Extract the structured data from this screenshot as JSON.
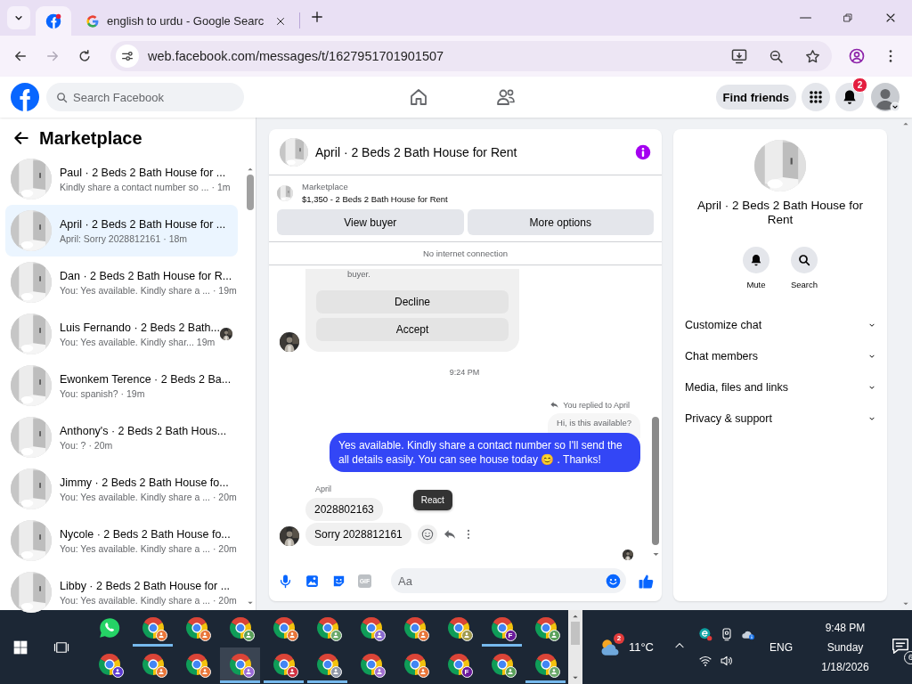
{
  "browser": {
    "tabs": [
      {
        "kind": "facebook",
        "selected": true
      },
      {
        "kind": "google",
        "title": "english to urdu - Google Searc",
        "selected": false
      }
    ],
    "nav": [
      {
        "kind": "back",
        "disabled": false
      },
      {
        "kind": "forward",
        "disabled": true
      },
      {
        "kind": "reload",
        "disabled": false
      }
    ],
    "url": "web.facebook.com/messages/t/1627951701901507"
  },
  "header": {
    "search_placeholder": "Search Facebook",
    "find_friends": "Find friends",
    "notification_count": "2"
  },
  "sidebar": {
    "title": "Marketplace",
    "conversations": [
      {
        "title": "Paul · 2 Beds 2 Bath House for ...",
        "preview": "Kindly share a contact number so ...",
        "time": "· 1m",
        "selected": false,
        "seen_avatar": false
      },
      {
        "title": "April · 2 Beds 2 Bath House for ...",
        "preview": "April: Sorry 2028812161",
        "time": "· 18m",
        "selected": true,
        "seen_avatar": false
      },
      {
        "title": "Dan · 2 Beds 2 Bath House for R...",
        "preview": "You: Yes available. Kindly share a ...",
        "time": "· 19m",
        "selected": false,
        "seen_avatar": false
      },
      {
        "title": "Luis Fernando · 2 Beds 2 Bath...",
        "preview": "You: Yes available. Kindly shar...",
        "time": "19m",
        "selected": false,
        "seen_avatar": true
      },
      {
        "title": "Ewonkem Terence · 2 Beds 2 Ba...",
        "preview": "You: spanish?",
        "time": "· 19m",
        "selected": false,
        "seen_avatar": false
      },
      {
        "title": "Anthony's · 2 Beds 2 Bath Hous...",
        "preview": "You: ?",
        "time": "· 20m",
        "selected": false,
        "seen_avatar": false
      },
      {
        "title": "Jimmy · 2 Beds 2 Bath House fo...",
        "preview": "You: Yes available. Kindly share a ...",
        "time": "· 20m",
        "selected": false,
        "seen_avatar": false
      },
      {
        "title": "Nycole · 2 Beds 2 Bath House fo...",
        "preview": "You: Yes available. Kindly share a ...",
        "time": "· 20m",
        "selected": false,
        "seen_avatar": false
      },
      {
        "title": "Libby · 2 Beds 2 Bath House for ...",
        "preview": "You: Yes available. Kindly share a ...",
        "time": "· 20m",
        "selected": false,
        "seen_avatar": false
      }
    ]
  },
  "chat": {
    "title": "April · 2 Beds 2 Bath House for Rent",
    "listing": {
      "label": "Marketplace",
      "price_title": "$1,350 - 2 Beds 2 Bath House for Rent",
      "buttons": [
        "View buyer",
        "More options"
      ]
    },
    "connection_notice": "No internet connection",
    "offer_card": {
      "text": "buyer.",
      "buttons": [
        "Decline",
        "Accept"
      ]
    },
    "timestamp": "9:24 PM",
    "reply_label": "You replied to April",
    "quoted": "Hi, is this available?",
    "outgoing": "Yes available. Kindly share a contact number so I'll send the all details easily. You can see house today 😊 . Thanks!",
    "sender": "April",
    "incoming": [
      "2028802163",
      "Sorry 2028812161"
    ],
    "tooltip": "React",
    "composer_placeholder": "Aa",
    "gif_label": "GIF"
  },
  "details": {
    "title": "April · 2 Beds 2 Bath House for Rent",
    "actions": [
      {
        "kind": "mute",
        "label": "Mute"
      },
      {
        "kind": "search",
        "label": "Search"
      }
    ],
    "sections": [
      {
        "label": "Customize chat",
        "expanded": false
      },
      {
        "label": "Chat members",
        "expanded": false
      },
      {
        "label": "Media, files and links",
        "expanded": false
      },
      {
        "label": "Privacy & support",
        "expanded": false
      }
    ]
  },
  "taskbar": {
    "rows": [
      [
        {
          "kind": "whatsapp",
          "open": false,
          "selected": false
        },
        {
          "kind": "browser",
          "color": "#e8763a",
          "open": true,
          "selected": false
        },
        {
          "kind": "browser",
          "color": "#e8763a",
          "open": false,
          "selected": false
        },
        {
          "kind": "browser",
          "color": "#5aa05a",
          "open": false,
          "selected": false
        },
        {
          "kind": "browser",
          "color": "#e8763a",
          "open": false,
          "selected": false
        },
        {
          "kind": "browser",
          "color": "#6aa86a",
          "open": false,
          "selected": false
        },
        {
          "kind": "browser",
          "color": "#8a6bd0",
          "open": false,
          "selected": false
        },
        {
          "kind": "browser",
          "color": "#e8763a",
          "open": false,
          "selected": false
        },
        {
          "kind": "browser",
          "color": "#a09a50",
          "open": false,
          "selected": false
        },
        {
          "kind": "browser",
          "color": "#6a1b9a",
          "letter": "F",
          "open": true,
          "selected": false
        },
        {
          "kind": "browser",
          "color": "#5aa05a",
          "open": false,
          "selected": false
        }
      ],
      [
        {
          "kind": "browser",
          "color": "#5b3ad0",
          "open": false,
          "selected": false
        },
        {
          "kind": "browser",
          "color": "#e8763a",
          "open": false,
          "selected": false
        },
        {
          "kind": "browser",
          "color": "#e8763a",
          "open": false,
          "selected": false
        },
        {
          "kind": "browser",
          "color": "#9a6ad8",
          "open": true,
          "selected": true
        },
        {
          "kind": "browser",
          "color": "#d03040",
          "open": true,
          "selected": false
        },
        {
          "kind": "browser",
          "color": "#9098a8",
          "open": true,
          "selected": false
        },
        {
          "kind": "browser",
          "color": "#a070d0",
          "open": false,
          "selected": false
        },
        {
          "kind": "browser",
          "color": "#e8763a",
          "open": false,
          "selected": false
        },
        {
          "kind": "browser",
          "color": "#6a1b9a",
          "letter": "F",
          "open": false,
          "selected": false
        },
        {
          "kind": "browser",
          "color": "#5aa05a",
          "open": false,
          "selected": false
        },
        {
          "kind": "browser",
          "color": "#6aa86a",
          "open": true,
          "selected": false
        }
      ]
    ],
    "weather_badge": "2",
    "temperature": "11°C",
    "language": "ENG",
    "time": "9:48 PM",
    "day": "Sunday",
    "date": "1/18/2026",
    "notification_count": "6"
  }
}
